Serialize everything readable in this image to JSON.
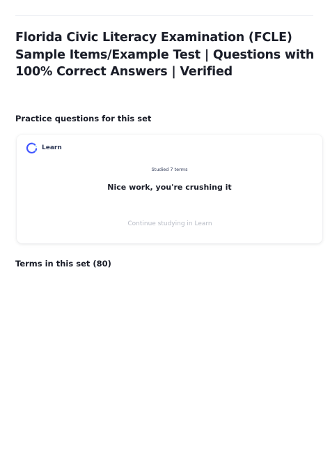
{
  "page": {
    "title": "Florida Civic Literacy Examination (FCLE) Sample Items/Example Test | Questions with 100% Correct Answers | Verified"
  },
  "practice": {
    "heading": "Practice questions for this set",
    "card": {
      "mode_label": "Learn",
      "mode_icon": "learn-progress-icon",
      "studied_text": "Studied 7 terms",
      "message": "Nice work, you're crushing it",
      "continue_label": "Continue studying in Learn"
    }
  },
  "terms": {
    "heading": "Terms in this set (80)"
  },
  "colors": {
    "learn_icon_primary": "#4255ff",
    "learn_icon_secondary": "#98e3ff",
    "text_primary": "#1a1d28",
    "text_muted": "#b8bcc6"
  }
}
